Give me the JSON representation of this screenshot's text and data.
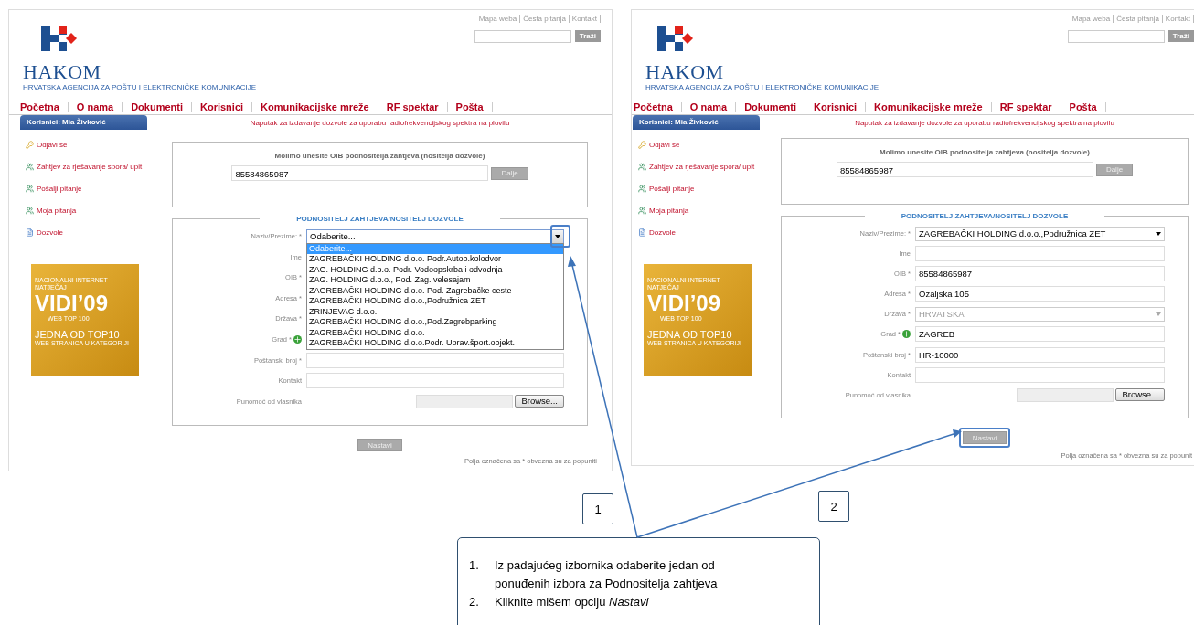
{
  "screens": [
    {
      "top_links": [
        "Mapa weba",
        "Česta pitanja",
        "Kontakt"
      ],
      "search_button": "Traži",
      "logo_text": "HAKOM",
      "agency": "HRVATSKA AGENCIJA ZA POŠTU I ELEKTRONIČKE KOMUNIKACIJE",
      "nav": [
        "Početna",
        "O nama",
        "Dokumenti",
        "Korisnici",
        "Komunikacijske mreže",
        "RF spektar",
        "Pošta"
      ],
      "user_label": "Korisnici: Mia Živković",
      "notice": "Naputak za izdavanje dozvole za uporabu radiofrekvencijskog spektra na plovilu",
      "sidebar": [
        {
          "kind": "key",
          "label": "Odjavi se"
        },
        {
          "kind": "group",
          "label": "Zahtjev za rješavanje spora/ upit"
        },
        {
          "kind": "group",
          "label": "Pošalji pitanje"
        },
        {
          "kind": "group",
          "label": "Moja pitanja"
        },
        {
          "kind": "document",
          "label": "Dozvole"
        }
      ],
      "banner": [
        "NACIONALNI INTERNET NATJEČAJ",
        "VIDI’09",
        "WEB TOP 100",
        "JEDNA OD TOP10",
        "WEB STRANICA U KATEGORIJI"
      ],
      "oib_prompt": "Molimo unesite OIB podnositelja zahtjeva (nositelja dozvole)",
      "oib_value": "85584865987",
      "oib_button": "Dalje",
      "section_title": "PODNOSITELJ ZAHTJEVA/NOSITELJ DOZVOLE",
      "fields": [
        {
          "kind": "select",
          "label": "Naziv/Prezime: *",
          "value": "Odaberite...",
          "open": true,
          "highlighted": true,
          "options": [
            {
              "label": "Odaberite...",
              "selected": true
            },
            {
              "label": "ZAGREBAČKI HOLDING d.o.o. Podr.Autob.kolodvor",
              "selected": false
            },
            {
              "label": "ZAG. HOLDING d.o.o. Podr. Vodoopskrba i odvodnja",
              "selected": false
            },
            {
              "label": "ZAG. HOLDING d.o.o., Pod. Zag. velesajam",
              "selected": false
            },
            {
              "label": "ZAGREBAČKI HOLDING d.o.o. Pod. Zagrebačke ceste",
              "selected": false
            },
            {
              "label": "ZAGREBAČKI HOLDING d.o.o.,Podružnica ZET",
              "selected": false
            },
            {
              "label": "ZRINJEVAC d.o.o.",
              "selected": false
            },
            {
              "label": "ZAGREBAČKI HOLDING d.o.o.,Pod.Zagrebparking",
              "selected": false
            },
            {
              "label": "ZAGREBAČKI HOLDING d.o.o.",
              "selected": false
            },
            {
              "label": "ZAGREBAČKI HOLDING d.o.o.Podr. Uprav.šport.objekt.",
              "selected": false
            }
          ]
        },
        {
          "kind": "text",
          "label": "Ime"
        },
        {
          "kind": "text",
          "label": "OIB *"
        },
        {
          "kind": "text",
          "label": "Adresa *"
        },
        {
          "kind": "text",
          "label": "Država *"
        },
        {
          "kind": "text",
          "label": "Grad *",
          "add_button": true
        },
        {
          "kind": "text",
          "label": "Poštanski broj *"
        },
        {
          "kind": "text",
          "label": "Kontakt"
        },
        {
          "kind": "file",
          "label": "Punomoć od vlasnika",
          "button": "Browse..."
        }
      ],
      "submit": "Nastavi",
      "submit_highlighted": false,
      "footnote": "Polja označena sa * obvezna su za popuniti"
    },
    {
      "top_links": [
        "Mapa weba",
        "Česta pitanja",
        "Kontakt"
      ],
      "search_button": "Traži",
      "logo_text": "HAKOM",
      "agency": "HRVATSKA AGENCIJA ZA POŠTU I ELEKTRONIČKE KOMUNIKACIJE",
      "nav": [
        "Početna",
        "O nama",
        "Dokumenti",
        "Korisnici",
        "Komunikacijske mreže",
        "RF spektar",
        "Pošta"
      ],
      "user_label": "Korisnici: Mia Živković",
      "notice": "Naputak za izdavanje dozvole za uporabu radiofrekvencijskog spektra na plovilu",
      "sidebar": [
        {
          "kind": "key",
          "label": "Odjavi se"
        },
        {
          "kind": "group",
          "label": "Zahtjev za rješavanje spora/ upit"
        },
        {
          "kind": "group",
          "label": "Pošalji pitanje"
        },
        {
          "kind": "group",
          "label": "Moja pitanja"
        },
        {
          "kind": "document",
          "label": "Dozvole"
        }
      ],
      "banner": [
        "NACIONALNI INTERNET NATJEČAJ",
        "VIDI’09",
        "WEB TOP 100",
        "JEDNA OD TOP10",
        "WEB STRANICA U KATEGORIJI"
      ],
      "oib_prompt": "Molimo unesite OIB podnositelja zahtjeva (nositelja dozvole)",
      "oib_value": "85584865987",
      "oib_button": "Dalje",
      "section_title": "PODNOSITELJ ZAHTJEVA/NOSITELJ DOZVOLE",
      "fields": [
        {
          "kind": "select",
          "label": "Naziv/Prezime: *",
          "value": "ZAGREBAČKI HOLDING d.o.o.,Podružnica ZET",
          "open": false,
          "highlighted": false
        },
        {
          "kind": "text",
          "label": "Ime"
        },
        {
          "kind": "text",
          "label": "OIB *",
          "value": "85584865987"
        },
        {
          "kind": "text",
          "label": "Adresa *",
          "value": "Ozaljska 105"
        },
        {
          "kind": "select",
          "label": "Država *",
          "value": "HRVATSKA",
          "disabled": true
        },
        {
          "kind": "text",
          "label": "Grad *",
          "value": "ZAGREB",
          "add_button": true
        },
        {
          "kind": "text",
          "label": "Poštanski broj *",
          "value": "HR-10000"
        },
        {
          "kind": "text",
          "label": "Kontakt"
        },
        {
          "kind": "file",
          "label": "Punomoć od vlasnika",
          "button": "Browse..."
        }
      ],
      "submit": "Nastavi",
      "submit_highlighted": true,
      "footnote": "Polja označena sa * obvezna su za popunit"
    }
  ],
  "callouts": [
    "1",
    "2"
  ],
  "instructions": [
    {
      "number": "1.",
      "text": "Iz padajućeg izbornika odaberite jedan od ponuđenih izbora za Podnositelja zahtjeva"
    },
    {
      "number": "2.",
      "text": "Kliknite mišem opciju *Nastavi*"
    }
  ]
}
